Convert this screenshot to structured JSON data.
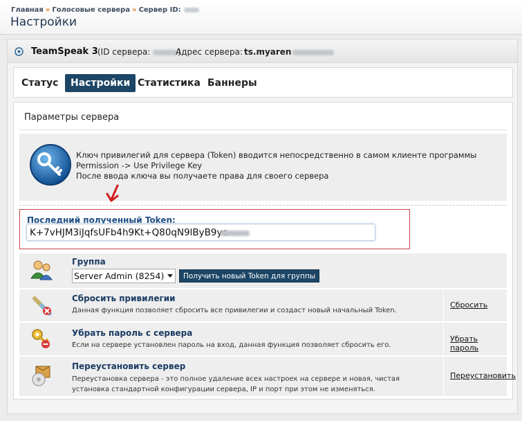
{
  "breadcrumb": {
    "items": [
      "Главная",
      "Голосовые сервера",
      "Сервер ID:"
    ],
    "separator": "»"
  },
  "page_title": "Настройки",
  "server": {
    "product": "TeamSpeak 3",
    "id_prefix": "(ID сервера:",
    "id_suffix": ")",
    "address_label": "Адрес сервера:",
    "address_value": "ts.myaren"
  },
  "tabs": [
    {
      "label": "Статус",
      "active": false
    },
    {
      "label": "Настройки",
      "active": true
    },
    {
      "label": "Статистика",
      "active": false
    },
    {
      "label": "Баннеры",
      "active": false
    }
  ],
  "section_title": "Параметры сервера",
  "info": {
    "line1": "Ключ привилегий для сервера (Token) вводится непосредственно в самом клиенте программы",
    "line2": "Permission -> Use Privilege Key",
    "line3": "После ввода ключа вы получаете права для своего сервера"
  },
  "token": {
    "label": "Последний полученный Token:",
    "value": "K+7vHJM3iJqfsUFb4h9Kt+Q80qN9lByB9yc"
  },
  "group": {
    "title": "Группа",
    "selected": "Server Admin (8254)",
    "button_label": "Получить новый Token для группы"
  },
  "actions": [
    {
      "title": "Сбросить привилегии",
      "desc": "Данная функция позволяет сбросить все привилегии и создаст новый начальный Token.",
      "link": "Сбросить",
      "icon": "reset-privileges-icon"
    },
    {
      "title": "Убрать пароль с сервера",
      "desc": "Если на сервере установлен пароль на вход, данная функция позволяет сбросить его.",
      "link": "Убрать пароль",
      "icon": "remove-password-icon"
    },
    {
      "title": "Переустановить сервер",
      "desc": "Переустановка сервера - это полное удаление всех настроек на сервере и новая, чистая установка стандартной конфигурации сервера, IP и порт при этом не изменяться.",
      "link": "Переустановить",
      "icon": "reinstall-icon"
    }
  ],
  "colors": {
    "accent": "#1d4666",
    "token_border": "#c84141",
    "link_title": "#1a3b63"
  }
}
